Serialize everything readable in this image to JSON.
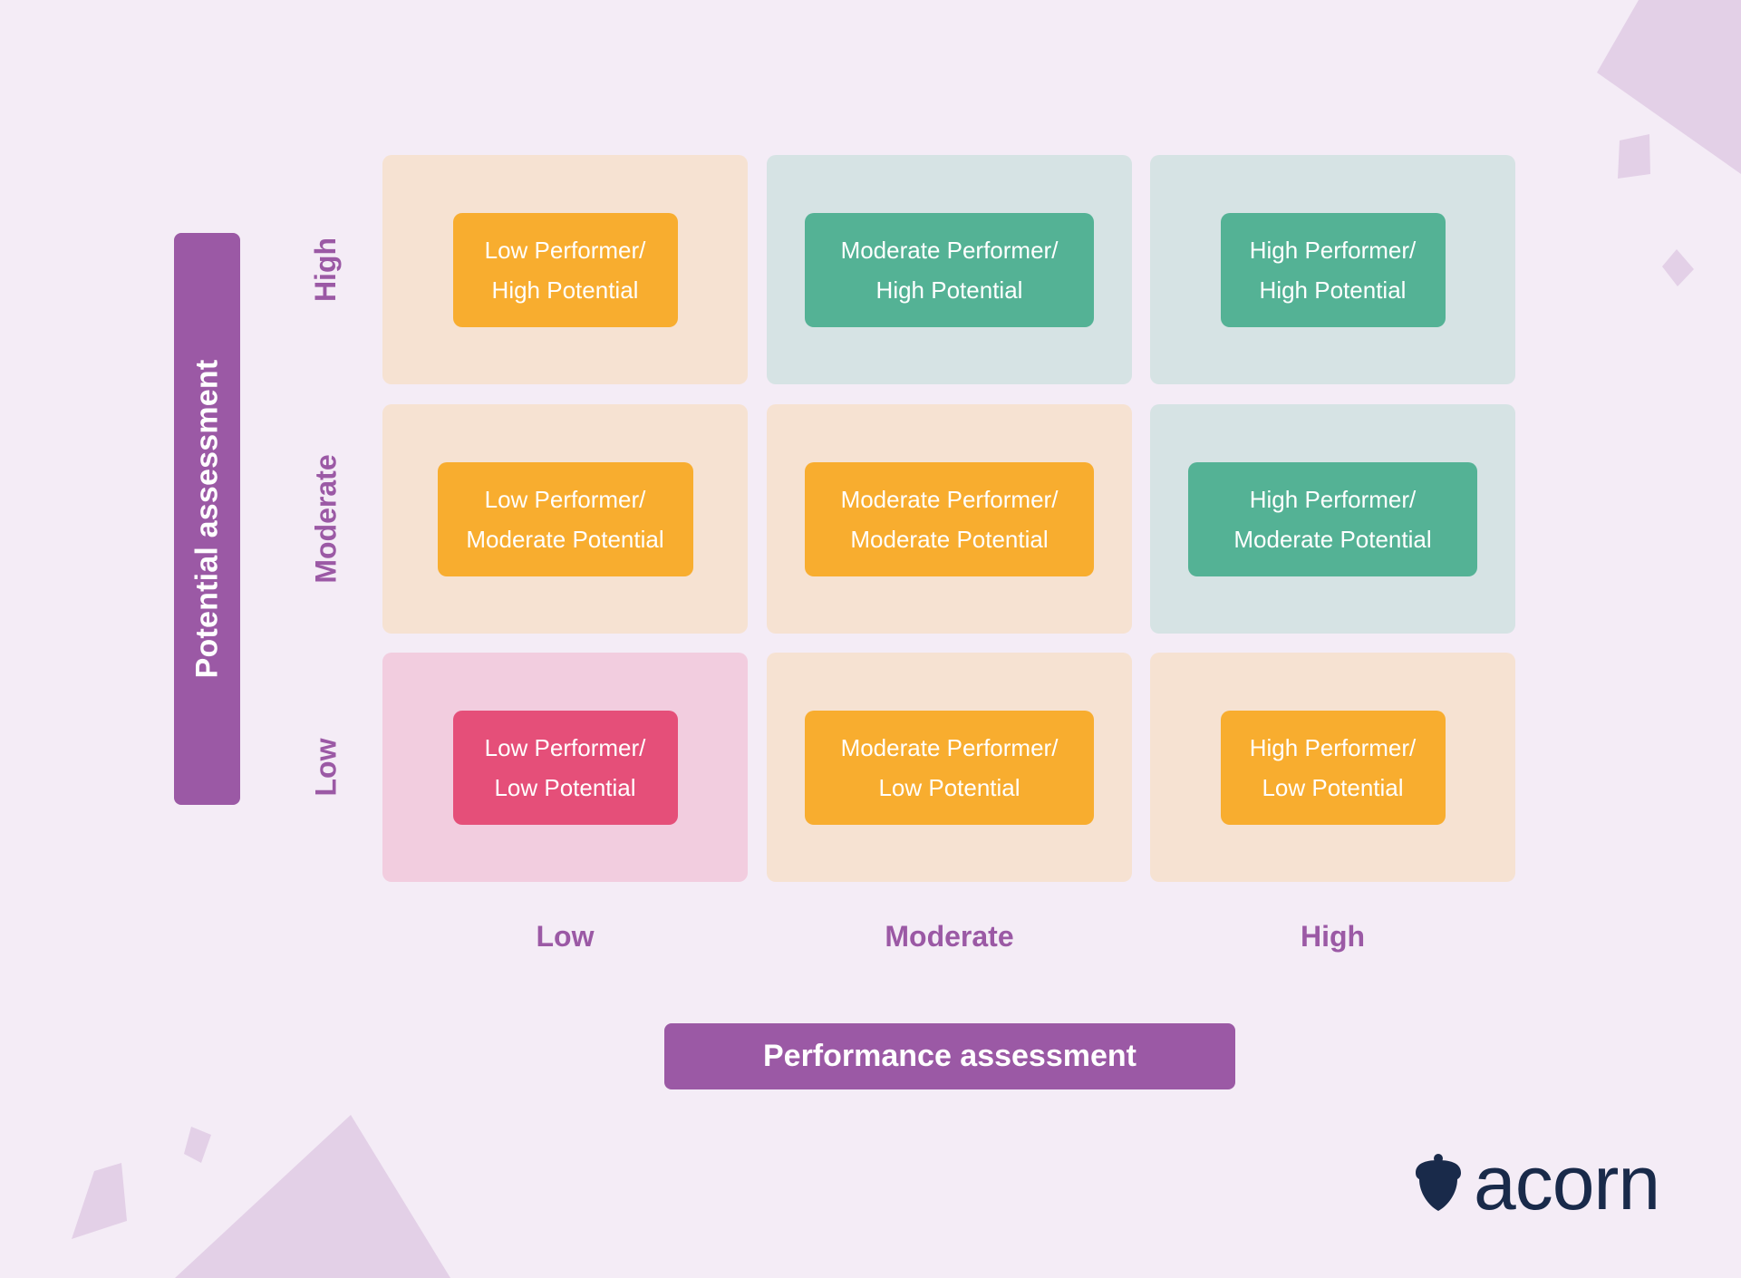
{
  "diagram": {
    "type": "9-box talent grid",
    "y_axis": {
      "title": "Potential assessment",
      "levels": [
        "High",
        "Moderate",
        "Low"
      ]
    },
    "x_axis": {
      "title": "Performance assessment",
      "levels": [
        "Low",
        "Moderate",
        "High"
      ]
    },
    "rows": [
      {
        "potential": "High",
        "cells": [
          {
            "line1": "Low Performer/",
            "line2": "High Potential",
            "tone": "orange"
          },
          {
            "line1": "Moderate Performer/",
            "line2": "High Potential",
            "tone": "green"
          },
          {
            "line1": "High Performer/",
            "line2": "High Potential",
            "tone": "green"
          }
        ]
      },
      {
        "potential": "Moderate",
        "cells": [
          {
            "line1": "Low Performer/",
            "line2": "Moderate Potential",
            "tone": "orange"
          },
          {
            "line1": "Moderate Performer/",
            "line2": "Moderate Potential",
            "tone": "orange"
          },
          {
            "line1": "High Performer/",
            "line2": "Moderate Potential",
            "tone": "green"
          }
        ]
      },
      {
        "potential": "Low",
        "cells": [
          {
            "line1": "Low Performer/",
            "line2": "Low Potential",
            "tone": "red"
          },
          {
            "line1": "Moderate Performer/",
            "line2": "Low Potential",
            "tone": "orange"
          },
          {
            "line1": "High Performer/",
            "line2": "Low Potential",
            "tone": "orange"
          }
        ]
      }
    ]
  },
  "colors": {
    "background": "#f4ecf6",
    "axis_purple": "#9b59a5",
    "orange": "#f8ad2f",
    "green": "#54b295",
    "red": "#e54f79",
    "cell_peach": "#f6e2d2",
    "cell_teal": "#d6e3e4",
    "cell_pink": "#f2cddf",
    "logo_navy": "#192a4a"
  },
  "branding": {
    "logo_text": "acorn",
    "logo_icon": "acorn-icon"
  }
}
